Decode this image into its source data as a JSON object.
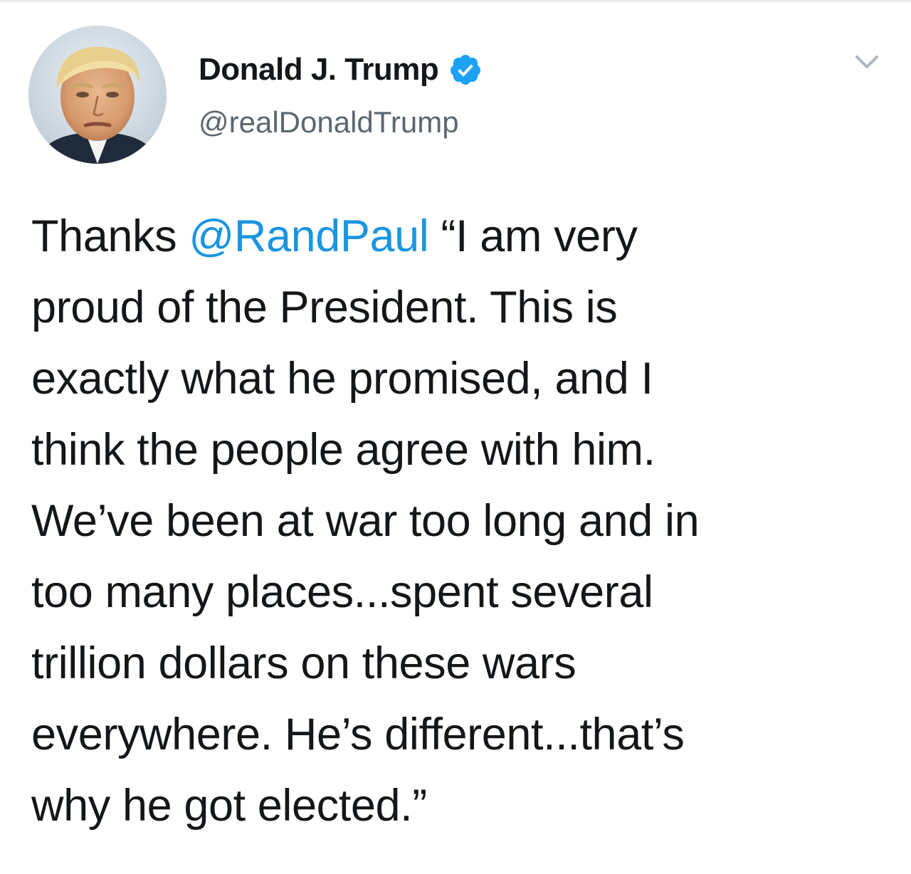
{
  "author": {
    "name": "Donald J. Trump",
    "handle": "@realDonaldTrump",
    "verified": true,
    "avatar_icon": "profile-photo",
    "verified_icon": "verified-badge-icon"
  },
  "menu": {
    "caret_icon": "chevron-down-icon"
  },
  "tweet": {
    "text_before": "Thanks ",
    "mention": "@RandPaul",
    "text_after": "  “I am very\nproud of the President. This is\nexactly what he promised, and I\nthink the people agree with him.\nWe’ve been at war too long and in\ntoo many places...spent several\ntrillion dollars on these wars\neverywhere. He’s different...that’s\nwhy he got elected.”"
  },
  "colors": {
    "text": "#14171a",
    "handle": "#5b6770",
    "mention": "#1b95e0",
    "verified": "#1da1f2",
    "caret": "#aab8c2",
    "background": "#ffffff"
  }
}
